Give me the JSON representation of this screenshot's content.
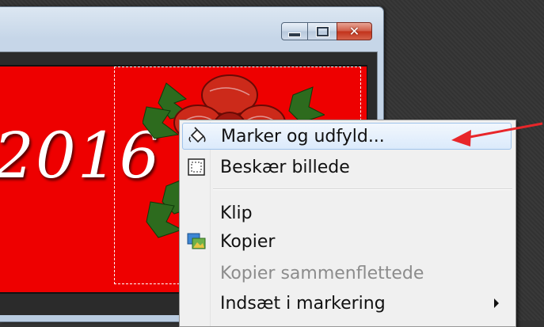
{
  "window": {
    "buttons": {
      "minimize": "minimize-icon",
      "maximize": "maximize-icon",
      "close": "close-icon"
    }
  },
  "canvas": {
    "image_text": "2016",
    "background_color": "#ee0000"
  },
  "context_menu": {
    "items": [
      {
        "label": "Marker og udfyld...",
        "icon": "paint-bucket-icon",
        "state": "highlighted"
      },
      {
        "label": "Beskær billede",
        "icon": "crop-selection-icon",
        "state": "enabled"
      },
      {
        "label": "Klip",
        "icon": "",
        "state": "enabled"
      },
      {
        "label": "Kopier",
        "icon": "copy-image-icon",
        "state": "enabled"
      },
      {
        "label": "Kopier sammenflettede",
        "icon": "",
        "state": "disabled"
      },
      {
        "label": "Indsæt i markering",
        "icon": "",
        "state": "enabled",
        "submenu": true
      }
    ]
  },
  "annotation": {
    "arrow_color": "#e8262a"
  }
}
